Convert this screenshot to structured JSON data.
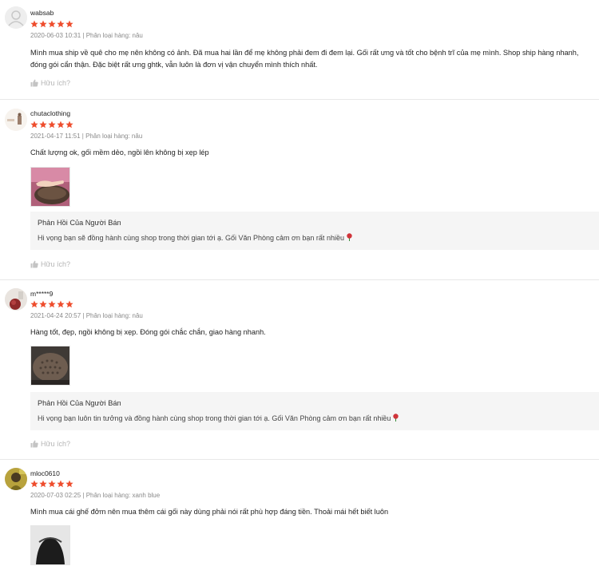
{
  "reviews": [
    {
      "username": "wabsab",
      "rating": 5,
      "meta": "2020-06-03 10:31 | Phân loại hàng: nâu",
      "comment": "Mình mua ship về quê cho mẹ nên không có ảnh. Đã mua hai lần để mẹ không phải đem đi đem lại. Gối rất ưng và tốt cho bệnh trĩ của mẹ mình. Shop ship hàng nhanh, đóng gói cẩn thận. Đặc biệt rất ưng ghtk, vẫn luôn là đơn vị vận chuyển mình thích nhất.",
      "helpful": "Hữu ích?"
    },
    {
      "username": "chutaclothing",
      "rating": 5,
      "meta": "2021-04-17 11:51 | Phân loại hàng: nâu",
      "comment": "Chất lượng ok, gối mềm dẻo, ngồi lên không bị xẹp lép",
      "seller_title": "Phản Hồi Của Người Bán",
      "seller_reply": "Hi vọng bạn sẽ đồng hành cùng shop trong thời gian tới ạ. Gối Văn Phòng cảm ơn bạn rất nhiều",
      "helpful": "Hữu ích?"
    },
    {
      "username": "m*****9",
      "rating": 5,
      "meta": "2021-04-24 20:57 | Phân loại hàng: nâu",
      "comment": "Hàng tốt, đẹp, ngồi không bị xẹp. Đóng gói chắc chắn, giao hàng nhanh.",
      "seller_title": "Phản Hồi Của Người Bán",
      "seller_reply": "Hi vọng bạn luôn tin tưởng và đồng hành cùng shop trong thời gian tới ạ. Gối Văn Phòng cảm ơn bạn rất nhiều",
      "helpful": "Hữu ích?"
    },
    {
      "username": "mloc0610",
      "rating": 5,
      "meta": "2020-07-03 02:25 | Phân loại hàng: xanh blue",
      "comment": "Mình mua cái ghế đởm nên mua thêm cái gối này dùng phải nói rất phù hợp đáng tiền. Thoải mái hết biết luôn"
    }
  ],
  "colors": {
    "star": "#ee4d2d",
    "helpful": "#b5b5b5",
    "seller_bg": "#f5f5f5"
  }
}
